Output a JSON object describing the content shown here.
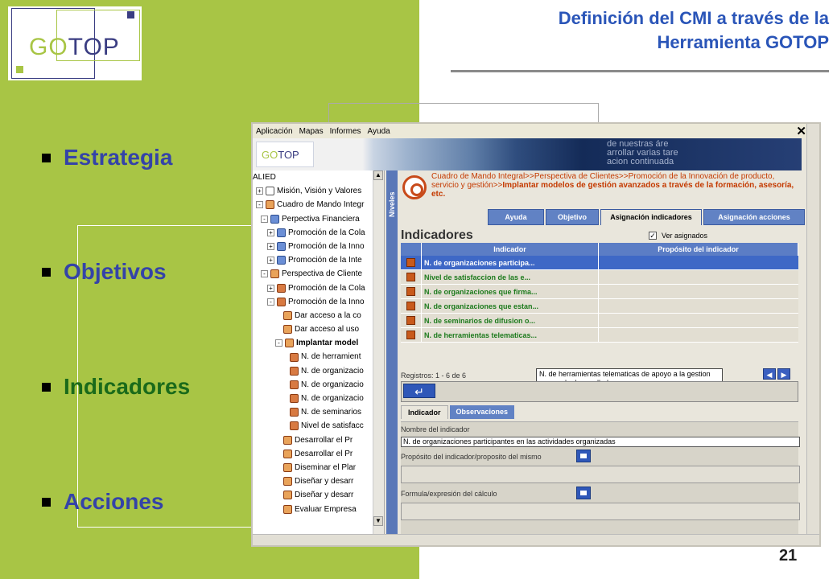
{
  "slide": {
    "title_line1": "Definición del CMI a través de la",
    "title_line2": "Herramienta GOTOP",
    "page_number": "21",
    "bullets": [
      {
        "label": "Estrategia",
        "color": "#3443a8"
      },
      {
        "label": "Objetivos",
        "color": "#3443a8"
      },
      {
        "label": "Indicadores",
        "color": "#1a6a1a"
      },
      {
        "label": "Acciones",
        "color": "#3443a8"
      }
    ],
    "logo": {
      "go": "GO",
      "top": "TOP"
    }
  },
  "app": {
    "menu": [
      "Aplicación",
      "Mapas",
      "Informes",
      "Ayuda"
    ],
    "close": "✕",
    "banner_logo": {
      "go": "GO",
      "top": "TOP"
    },
    "banner_text": [
      "de nuestras áre",
      "arrollar varias tare",
      "acion continuada"
    ],
    "tree_root": "ALIED",
    "tree": [
      {
        "label": "Misión, Visión y Valores",
        "icon": "doc",
        "toggle": "+"
      },
      {
        "label": "Cuadro de Mando Integr",
        "icon": "org",
        "toggle": "-"
      },
      {
        "label": "Perpectiva Financiera",
        "icon": "blue",
        "toggle": "-"
      },
      {
        "label": "Promoción de la Cola",
        "icon": "blue",
        "toggle": "+"
      },
      {
        "label": "Promoción de la Inno",
        "icon": "blue",
        "toggle": "+"
      },
      {
        "label": "Promoción de la Inte",
        "icon": "blue",
        "toggle": "+"
      },
      {
        "label": "Perspectiva de Cliente",
        "icon": "org",
        "toggle": "-"
      },
      {
        "label": "Promoción de la Cola",
        "icon": "red",
        "toggle": "+"
      },
      {
        "label": "Promoción de la Inno",
        "icon": "red",
        "toggle": "-"
      },
      {
        "label": "Dar acceso a la co",
        "icon": "org",
        "toggle": ""
      },
      {
        "label": "Dar acceso al uso",
        "icon": "org",
        "toggle": ""
      },
      {
        "label": "Implantar model",
        "icon": "org",
        "toggle": "-"
      },
      {
        "label": "N. de herramient",
        "icon": "red",
        "toggle": ""
      },
      {
        "label": "N. de organizacio",
        "icon": "red",
        "toggle": ""
      },
      {
        "label": "N. de organizacio",
        "icon": "red",
        "toggle": ""
      },
      {
        "label": "N. de organizacio",
        "icon": "red",
        "toggle": ""
      },
      {
        "label": "N. de seminarios",
        "icon": "red",
        "toggle": ""
      },
      {
        "label": "Nivel de satisfacc",
        "icon": "red",
        "toggle": ""
      },
      {
        "label": "Desarrollar el Pr",
        "icon": "org",
        "toggle": ""
      },
      {
        "label": "Desarrollar el Pr",
        "icon": "org",
        "toggle": ""
      },
      {
        "label": "Diseminar el Plar",
        "icon": "org",
        "toggle": ""
      },
      {
        "label": "Diseñar y desarr",
        "icon": "org",
        "toggle": ""
      },
      {
        "label": "Diseñar y desarr",
        "icon": "org",
        "toggle": ""
      },
      {
        "label": "Evaluar Empresa",
        "icon": "org",
        "toggle": ""
      }
    ],
    "niveles": "Niveles",
    "breadcrumb": "Cuadro de Mando Integral>>Perspectiva de Clientes>>Promoción de la Innovación de producto, servicio y gestión>>",
    "breadcrumb_bold": "Implantar modelos de gestión avanzados a través de la formación, asesoría, etc.",
    "tabs": [
      {
        "label": "Ayuda",
        "active": false
      },
      {
        "label": "Objetivo",
        "active": false
      },
      {
        "label": "Asignación indicadores",
        "active": true
      },
      {
        "label": "Asignación acciones",
        "active": false
      }
    ],
    "section_title": "Indicadores",
    "ver_asignados": "Ver asignados",
    "ver_checked": "✓",
    "columns": [
      "Indicador",
      "Propósito del indicador"
    ],
    "rows": [
      {
        "indicador": "N. de organizaciones participa...",
        "selected": true
      },
      {
        "indicador": "Nivel de satisfaccion de las e...",
        "selected": false
      },
      {
        "indicador": "N. de organizaciones que firma...",
        "selected": false
      },
      {
        "indicador": "N. de organizaciones que estan...",
        "selected": false
      },
      {
        "indicador": "N. de seminarios de difusion o...",
        "selected": false
      },
      {
        "indicador": "N. de herramientas telematicas...",
        "selected": false
      }
    ],
    "registros": "Registros: 1 - 6 de 6",
    "tooltip": "N. de herramientas telematicas de apoyo a la gestion avanzada desarrolladas",
    "nav_prev": "◀",
    "nav_next": "▶",
    "back_arrow": "↵",
    "bottom_tabs": [
      {
        "label": "Indicador",
        "active": true
      },
      {
        "label": "Observaciones",
        "active": false
      }
    ],
    "form": {
      "nombre_label": "Nombre del indicador",
      "nombre_value": "N. de organizaciones participantes en las actividades organizadas",
      "proposito_label": "Propósito del indicador/proposito del mismo",
      "formula_label": "Formula/expresión del cálculo"
    }
  }
}
